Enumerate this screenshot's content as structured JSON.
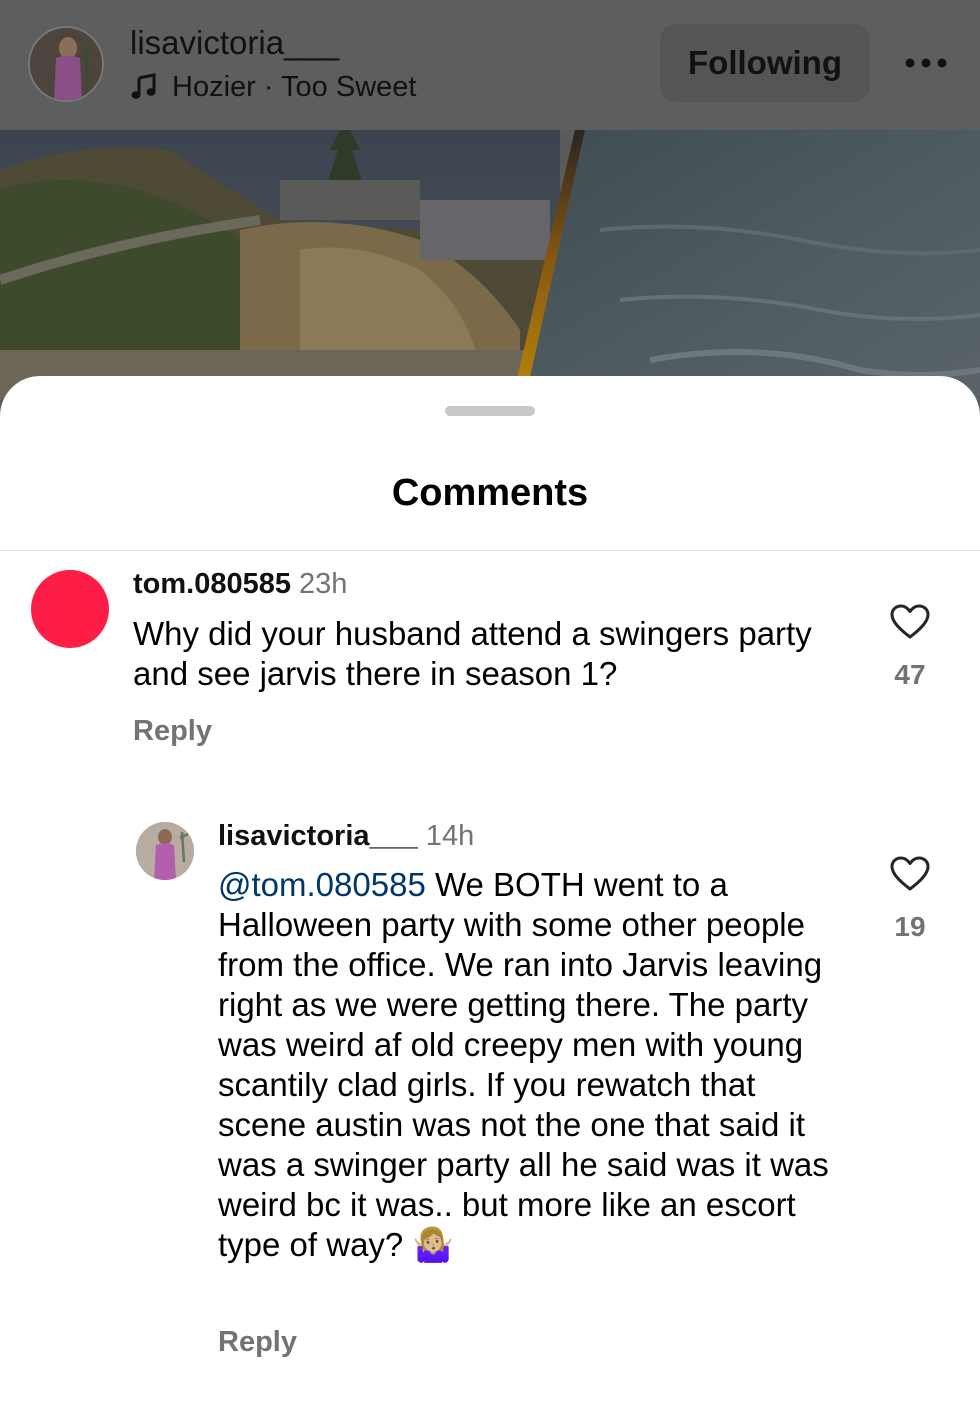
{
  "header": {
    "username": "lisavictoria___",
    "music": "Hozier · Too Sweet",
    "follow_label": "Following"
  },
  "sheet": {
    "title": "Comments"
  },
  "comments": [
    {
      "username": "tom.080585",
      "time": "23h",
      "text": "Why did your husband attend a swingers party and see jarvis there in season 1?",
      "reply_label": "Reply",
      "likes": "47",
      "avatar_color": "#fd1d46"
    },
    {
      "username": "lisavictoria___",
      "time": "14h",
      "mention": "@tom.080585",
      "text": "We BOTH went to a Halloween party with some other people from the office. We ran into Jarvis leaving right as we were getting there. The party was weird af old creepy men with young scantily clad girls. If you rewatch that scene austin was not the one that said it was a swinger party all he said was it was weird bc it was.. but more like an escort type of way? 🤷🏼‍♀️",
      "reply_label": "Reply",
      "likes": "19"
    }
  ],
  "colors": {
    "secondary_text": "#737373",
    "mention": "#00376b",
    "dim_overlay": "#5e5e5e"
  },
  "icons": [
    "music-note-icon",
    "more-icon",
    "heart-icon"
  ]
}
